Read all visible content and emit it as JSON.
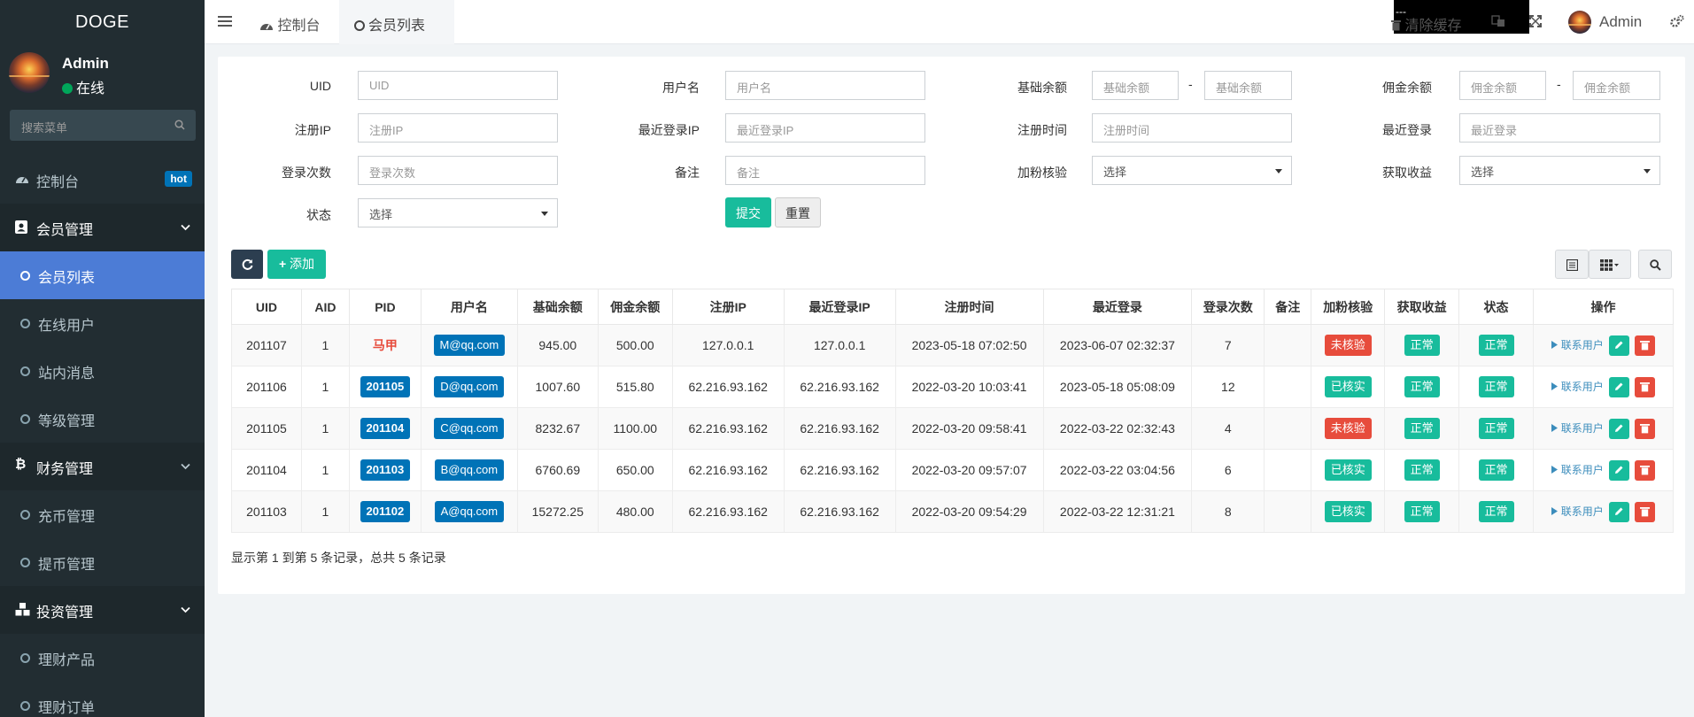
{
  "app": {
    "logo": "DOGE"
  },
  "user": {
    "name": "Admin",
    "status": "在线"
  },
  "sidebar": {
    "search_placeholder": "搜索菜单",
    "items": [
      {
        "label": "控制台",
        "badge": "hot"
      },
      {
        "label": "会员管理"
      },
      {
        "label": "会员列表"
      },
      {
        "label": "在线用户"
      },
      {
        "label": "站内消息"
      },
      {
        "label": "等级管理"
      },
      {
        "label": "财务管理"
      },
      {
        "label": "充币管理"
      },
      {
        "label": "提币管理"
      },
      {
        "label": "投资管理"
      },
      {
        "label": "理财产品"
      },
      {
        "label": "理财订单"
      }
    ]
  },
  "topbar": {
    "tabs": [
      {
        "label": "控制台"
      },
      {
        "label": "会员列表"
      }
    ],
    "black_text": "---",
    "clear_cache": "清除缓存",
    "admin": "Admin"
  },
  "filters": {
    "uid": {
      "label": "UID",
      "placeholder": "UID"
    },
    "username": {
      "label": "用户名",
      "placeholder": "用户名"
    },
    "base_balance": {
      "label": "基础余额",
      "placeholder": "基础余额"
    },
    "commission": {
      "label": "佣金余额",
      "placeholder": "佣金余额"
    },
    "reg_ip": {
      "label": "注册IP",
      "placeholder": "注册IP"
    },
    "last_ip": {
      "label": "最近登录IP",
      "placeholder": "最近登录IP"
    },
    "reg_time": {
      "label": "注册时间",
      "placeholder": "注册时间"
    },
    "last_login": {
      "label": "最近登录",
      "placeholder": "最近登录"
    },
    "login_count": {
      "label": "登录次数",
      "placeholder": "登录次数"
    },
    "remark": {
      "label": "备注",
      "placeholder": "备注"
    },
    "verify": {
      "label": "加粉核验",
      "value": "选择"
    },
    "earnings": {
      "label": "获取收益",
      "value": "选择"
    },
    "status": {
      "label": "状态",
      "value": "选择"
    },
    "range_sep": "-",
    "submit": "提交",
    "reset": "重置"
  },
  "toolbar": {
    "add": "添加"
  },
  "table": {
    "columns": [
      "UID",
      "AID",
      "PID",
      "用户名",
      "基础余额",
      "佣金余额",
      "注册IP",
      "最近登录IP",
      "注册时间",
      "最近登录",
      "登录次数",
      "备注",
      "加粉核验",
      "获取收益",
      "状态",
      "操作"
    ],
    "contact_label": "联系用户",
    "rows": [
      {
        "uid": "201107",
        "aid": "1",
        "pid": "马甲",
        "pid_style": "text",
        "username": "M@qq.com",
        "base": "945.00",
        "commission": "500.00",
        "reg_ip": "127.0.0.1",
        "last_ip": "127.0.0.1",
        "reg_time": "2023-05-18 07:02:50",
        "last_login": "2023-06-07 02:32:37",
        "logins": "7",
        "remark": "",
        "verify": "未核验",
        "verify_ok": false,
        "earnings": "正常",
        "status": "正常"
      },
      {
        "uid": "201106",
        "aid": "1",
        "pid": "201105",
        "pid_style": "label",
        "username": "D@qq.com",
        "base": "1007.60",
        "commission": "515.80",
        "reg_ip": "62.216.93.162",
        "last_ip": "62.216.93.162",
        "reg_time": "2022-03-20 10:03:41",
        "last_login": "2023-05-18 05:08:09",
        "logins": "12",
        "remark": "",
        "verify": "已核实",
        "verify_ok": true,
        "earnings": "正常",
        "status": "正常"
      },
      {
        "uid": "201105",
        "aid": "1",
        "pid": "201104",
        "pid_style": "label",
        "username": "C@qq.com",
        "base": "8232.67",
        "commission": "1100.00",
        "reg_ip": "62.216.93.162",
        "last_ip": "62.216.93.162",
        "reg_time": "2022-03-20 09:58:41",
        "last_login": "2022-03-22 02:32:43",
        "logins": "4",
        "remark": "",
        "verify": "未核验",
        "verify_ok": false,
        "earnings": "正常",
        "status": "正常"
      },
      {
        "uid": "201104",
        "aid": "1",
        "pid": "201103",
        "pid_style": "label",
        "username": "B@qq.com",
        "base": "6760.69",
        "commission": "650.00",
        "reg_ip": "62.216.93.162",
        "last_ip": "62.216.93.162",
        "reg_time": "2022-03-20 09:57:07",
        "last_login": "2022-03-22 03:04:56",
        "logins": "6",
        "remark": "",
        "verify": "已核实",
        "verify_ok": true,
        "earnings": "正常",
        "status": "正常"
      },
      {
        "uid": "201103",
        "aid": "1",
        "pid": "201102",
        "pid_style": "label",
        "username": "A@qq.com",
        "base": "15272.25",
        "commission": "480.00",
        "reg_ip": "62.216.93.162",
        "last_ip": "62.216.93.162",
        "reg_time": "2022-03-20 09:54:29",
        "last_login": "2022-03-22 12:31:21",
        "logins": "8",
        "remark": "",
        "verify": "已核实",
        "verify_ok": true,
        "earnings": "正常",
        "status": "正常"
      }
    ]
  },
  "pagination_info": "显示第 1 到第 5 条记录，总共 5 条记录",
  "colors": {
    "sidebar_bg": "#222d32",
    "active_item": "#4c7cd6",
    "success": "#18bc9c",
    "danger": "#e74c3c",
    "primary": "#0073b7"
  }
}
